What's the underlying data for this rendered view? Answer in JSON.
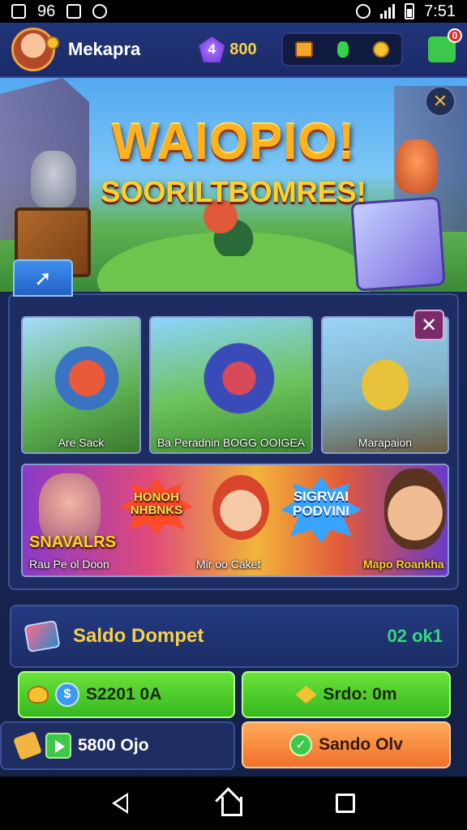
{
  "status_bar": {
    "left_text": "96",
    "time": "7:51"
  },
  "header": {
    "username": "Mekapra",
    "gem_badge": "4",
    "gem_value": "800",
    "notification_count": "0"
  },
  "banner": {
    "title": "WAIOPIO!",
    "subtitle": "SOORILTBOMRES!"
  },
  "games": [
    {
      "label": "Are Sack"
    },
    {
      "label": "Ba Peradnin BOGG OOIGEA"
    },
    {
      "label": "Marapaion"
    }
  ],
  "promo": {
    "left_title": "SNAVALRS",
    "burst1_text": "HONOH NHBNKS",
    "burst2_text": "SIGRVAI PODVINI",
    "captions": [
      "Rau Pe ol Doon",
      "Mir oo Caket",
      "Mapo Roankha"
    ]
  },
  "wallet": {
    "title": "Saldo Dompet",
    "amount": "02 ok1"
  },
  "buttons": {
    "b1": "S2201 0A",
    "b2": "Srdo: 0m",
    "b3": "5800 Ojo",
    "b4": "Sando Olv"
  },
  "colors": {
    "accent_gold": "#f6d04a",
    "accent_green": "#36b81e",
    "accent_orange": "#f0702a",
    "panel_bg": "#1d2d62"
  },
  "icons": [
    "photo-icon",
    "home-icon",
    "alarm-icon",
    "wifi-icon",
    "battery-icon",
    "gem-icon",
    "chest-icon",
    "coin-icon",
    "puzzle-icon",
    "tools-icon",
    "close-icon",
    "wallet-icon",
    "back-nav-icon",
    "home-nav-icon",
    "recent-apps-icon"
  ]
}
